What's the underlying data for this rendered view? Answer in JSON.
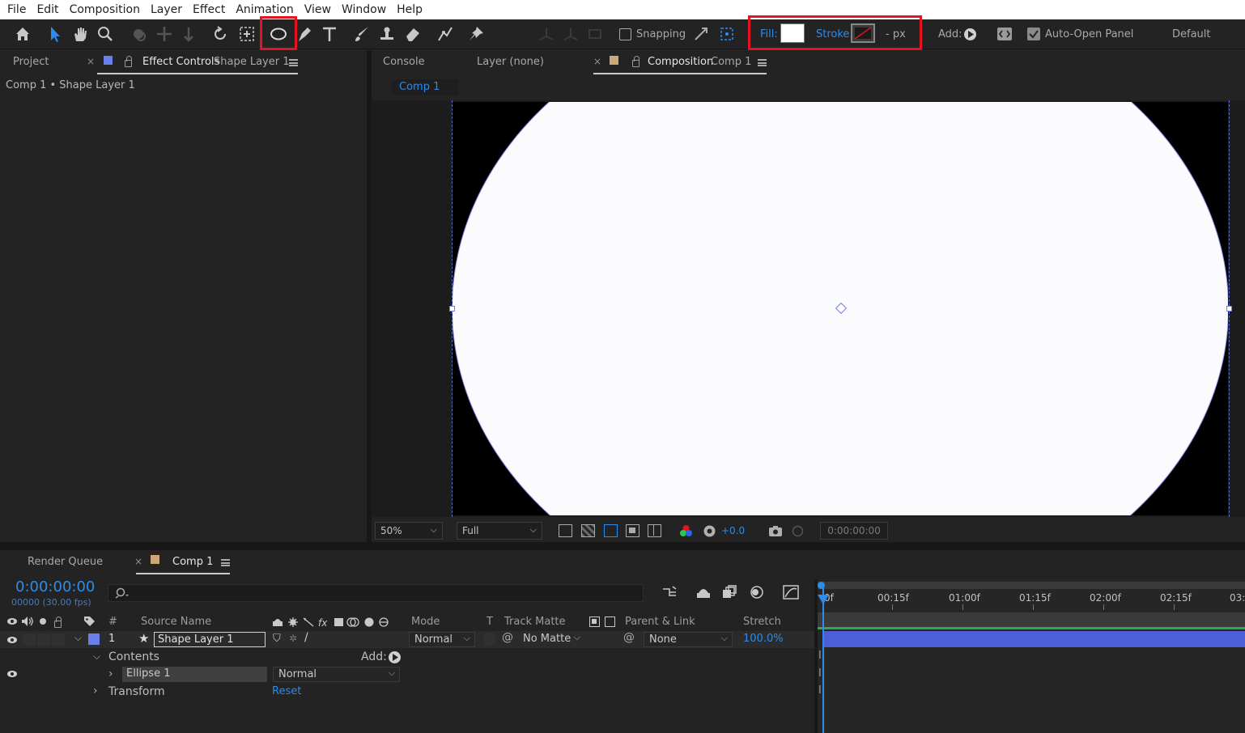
{
  "menu": [
    "File",
    "Edit",
    "Composition",
    "Layer",
    "Effect",
    "Animation",
    "View",
    "Window",
    "Help"
  ],
  "toolbar": {
    "snapping_label": "Snapping",
    "fill_label": "Fill:",
    "fill_color": "#ffffff",
    "stroke_label": "Stroke:",
    "stroke_width": "- px",
    "add_label": "Add:",
    "auto_open_label": "Auto-Open Panel",
    "workspace": "Default",
    "highlight_color": "#e3141f"
  },
  "left_panel": {
    "tab_project": "Project",
    "tab_effect_controls": "Effect Controls",
    "effect_controls_target": "Shape Layer 1",
    "breadcrumb": "Comp 1 • Shape Layer 1"
  },
  "right_panel": {
    "tab_console": "Console",
    "tab_layer": "Layer (none)",
    "tab_composition": "Composition",
    "composition_name": "Comp 1",
    "comp_subtab": "Comp 1"
  },
  "viewer_bar": {
    "zoom": "50%",
    "resolution": "Full",
    "exposure": "+0.0",
    "timecode": "0:00:00:00"
  },
  "timeline": {
    "tab_render_queue": "Render Queue",
    "tab_comp": "Comp 1",
    "current_time": "0:00:00:00",
    "frame_info": "00000 (30.00 fps)",
    "columns": {
      "number": "#",
      "source_name": "Source Name",
      "mode": "Mode",
      "t": "T",
      "track_matte": "Track Matte",
      "parent_link": "Parent & Link",
      "stretch": "Stretch"
    },
    "layer": {
      "index": "1",
      "name": "Shape Layer 1",
      "mode": "Normal",
      "track_matte": "No Matte",
      "parent": "None",
      "stretch": "100.0%",
      "label_color": "#6b7fe8"
    },
    "contents_label": "Contents",
    "contents_add": "Add:",
    "ellipse_name": "Ellipse 1",
    "ellipse_mode": "Normal",
    "transform_label": "Transform",
    "transform_reset": "Reset",
    "ruler": [
      "0f",
      "00:15f",
      "01:00f",
      "01:15f",
      "02:00f",
      "02:15f",
      "03:"
    ]
  }
}
